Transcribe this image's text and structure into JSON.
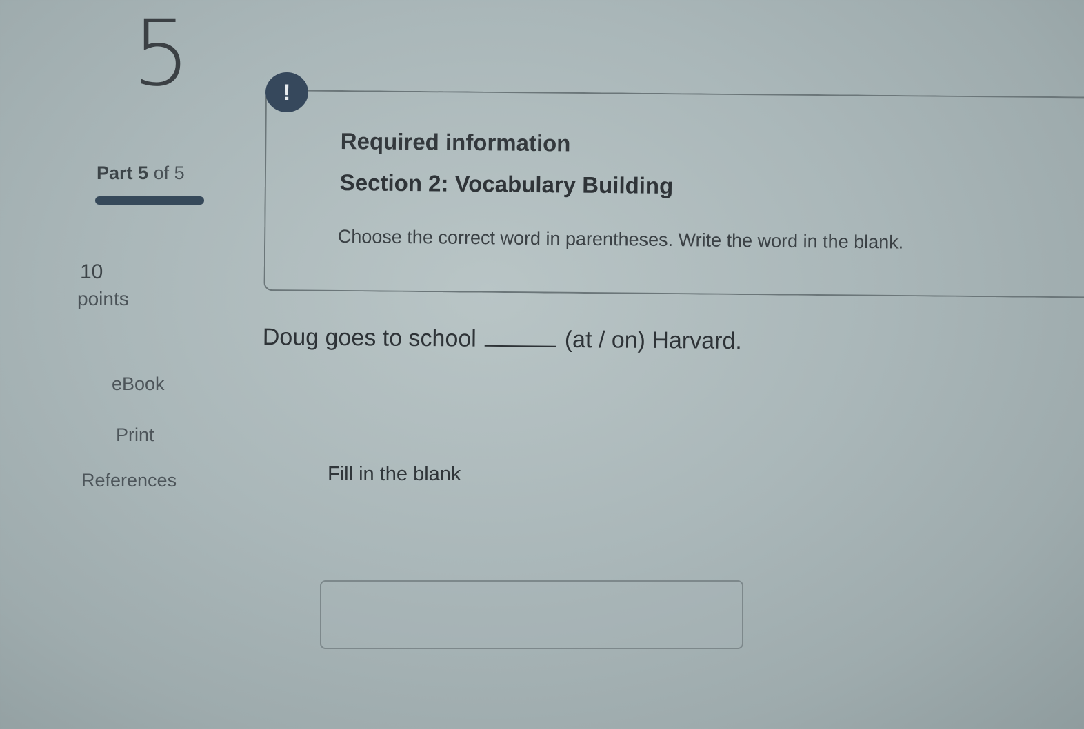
{
  "question": {
    "number": "5",
    "part_word": "Part",
    "part_current": "5",
    "part_suffix": "of 5",
    "points_value": "10",
    "points_unit": "points"
  },
  "sidebar": {
    "links": {
      "ebook": "eBook",
      "print": "Print",
      "references": "References"
    }
  },
  "info": {
    "badge_glyph": "!",
    "title": "Required information",
    "section": "Section 2: Vocabulary Building",
    "instructions": "Choose the correct word in parentheses. Write the word in the blank."
  },
  "prompt": {
    "before_blank": "Doug goes to school",
    "after_blank": "(at / on) Harvard."
  },
  "answer": {
    "label": "Fill in the blank",
    "value": "",
    "placeholder": ""
  },
  "colors": {
    "badge": "#36485c",
    "progress": "#36495a"
  }
}
